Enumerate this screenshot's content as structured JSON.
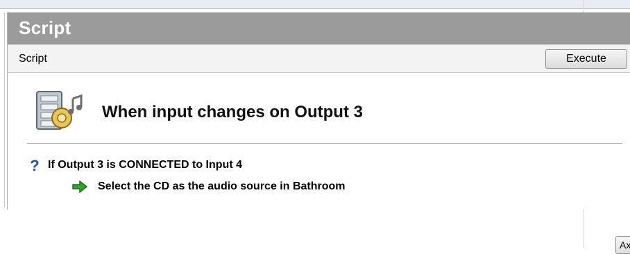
{
  "panel": {
    "title": "Script"
  },
  "toolbar": {
    "label": "Script",
    "execute_label": "Execute"
  },
  "event": {
    "icon": "media-video-audio-icon",
    "title": "When input changes on Output 3"
  },
  "condition": {
    "icon": "question-mark-icon",
    "text": "If Output 3 is CONNECTED to Input 4"
  },
  "action": {
    "icon": "green-arrow-right-icon",
    "text": "Select the CD as the audio source in Bathroom"
  },
  "partial_button": {
    "label": "Ax"
  },
  "colors": {
    "header_bg": "#9b9b9b",
    "header_text": "#ffffff",
    "toolbar_bg": "#f3f3f3",
    "arrow_green": "#2fa52a",
    "question_blue": "#1f4fc4"
  }
}
